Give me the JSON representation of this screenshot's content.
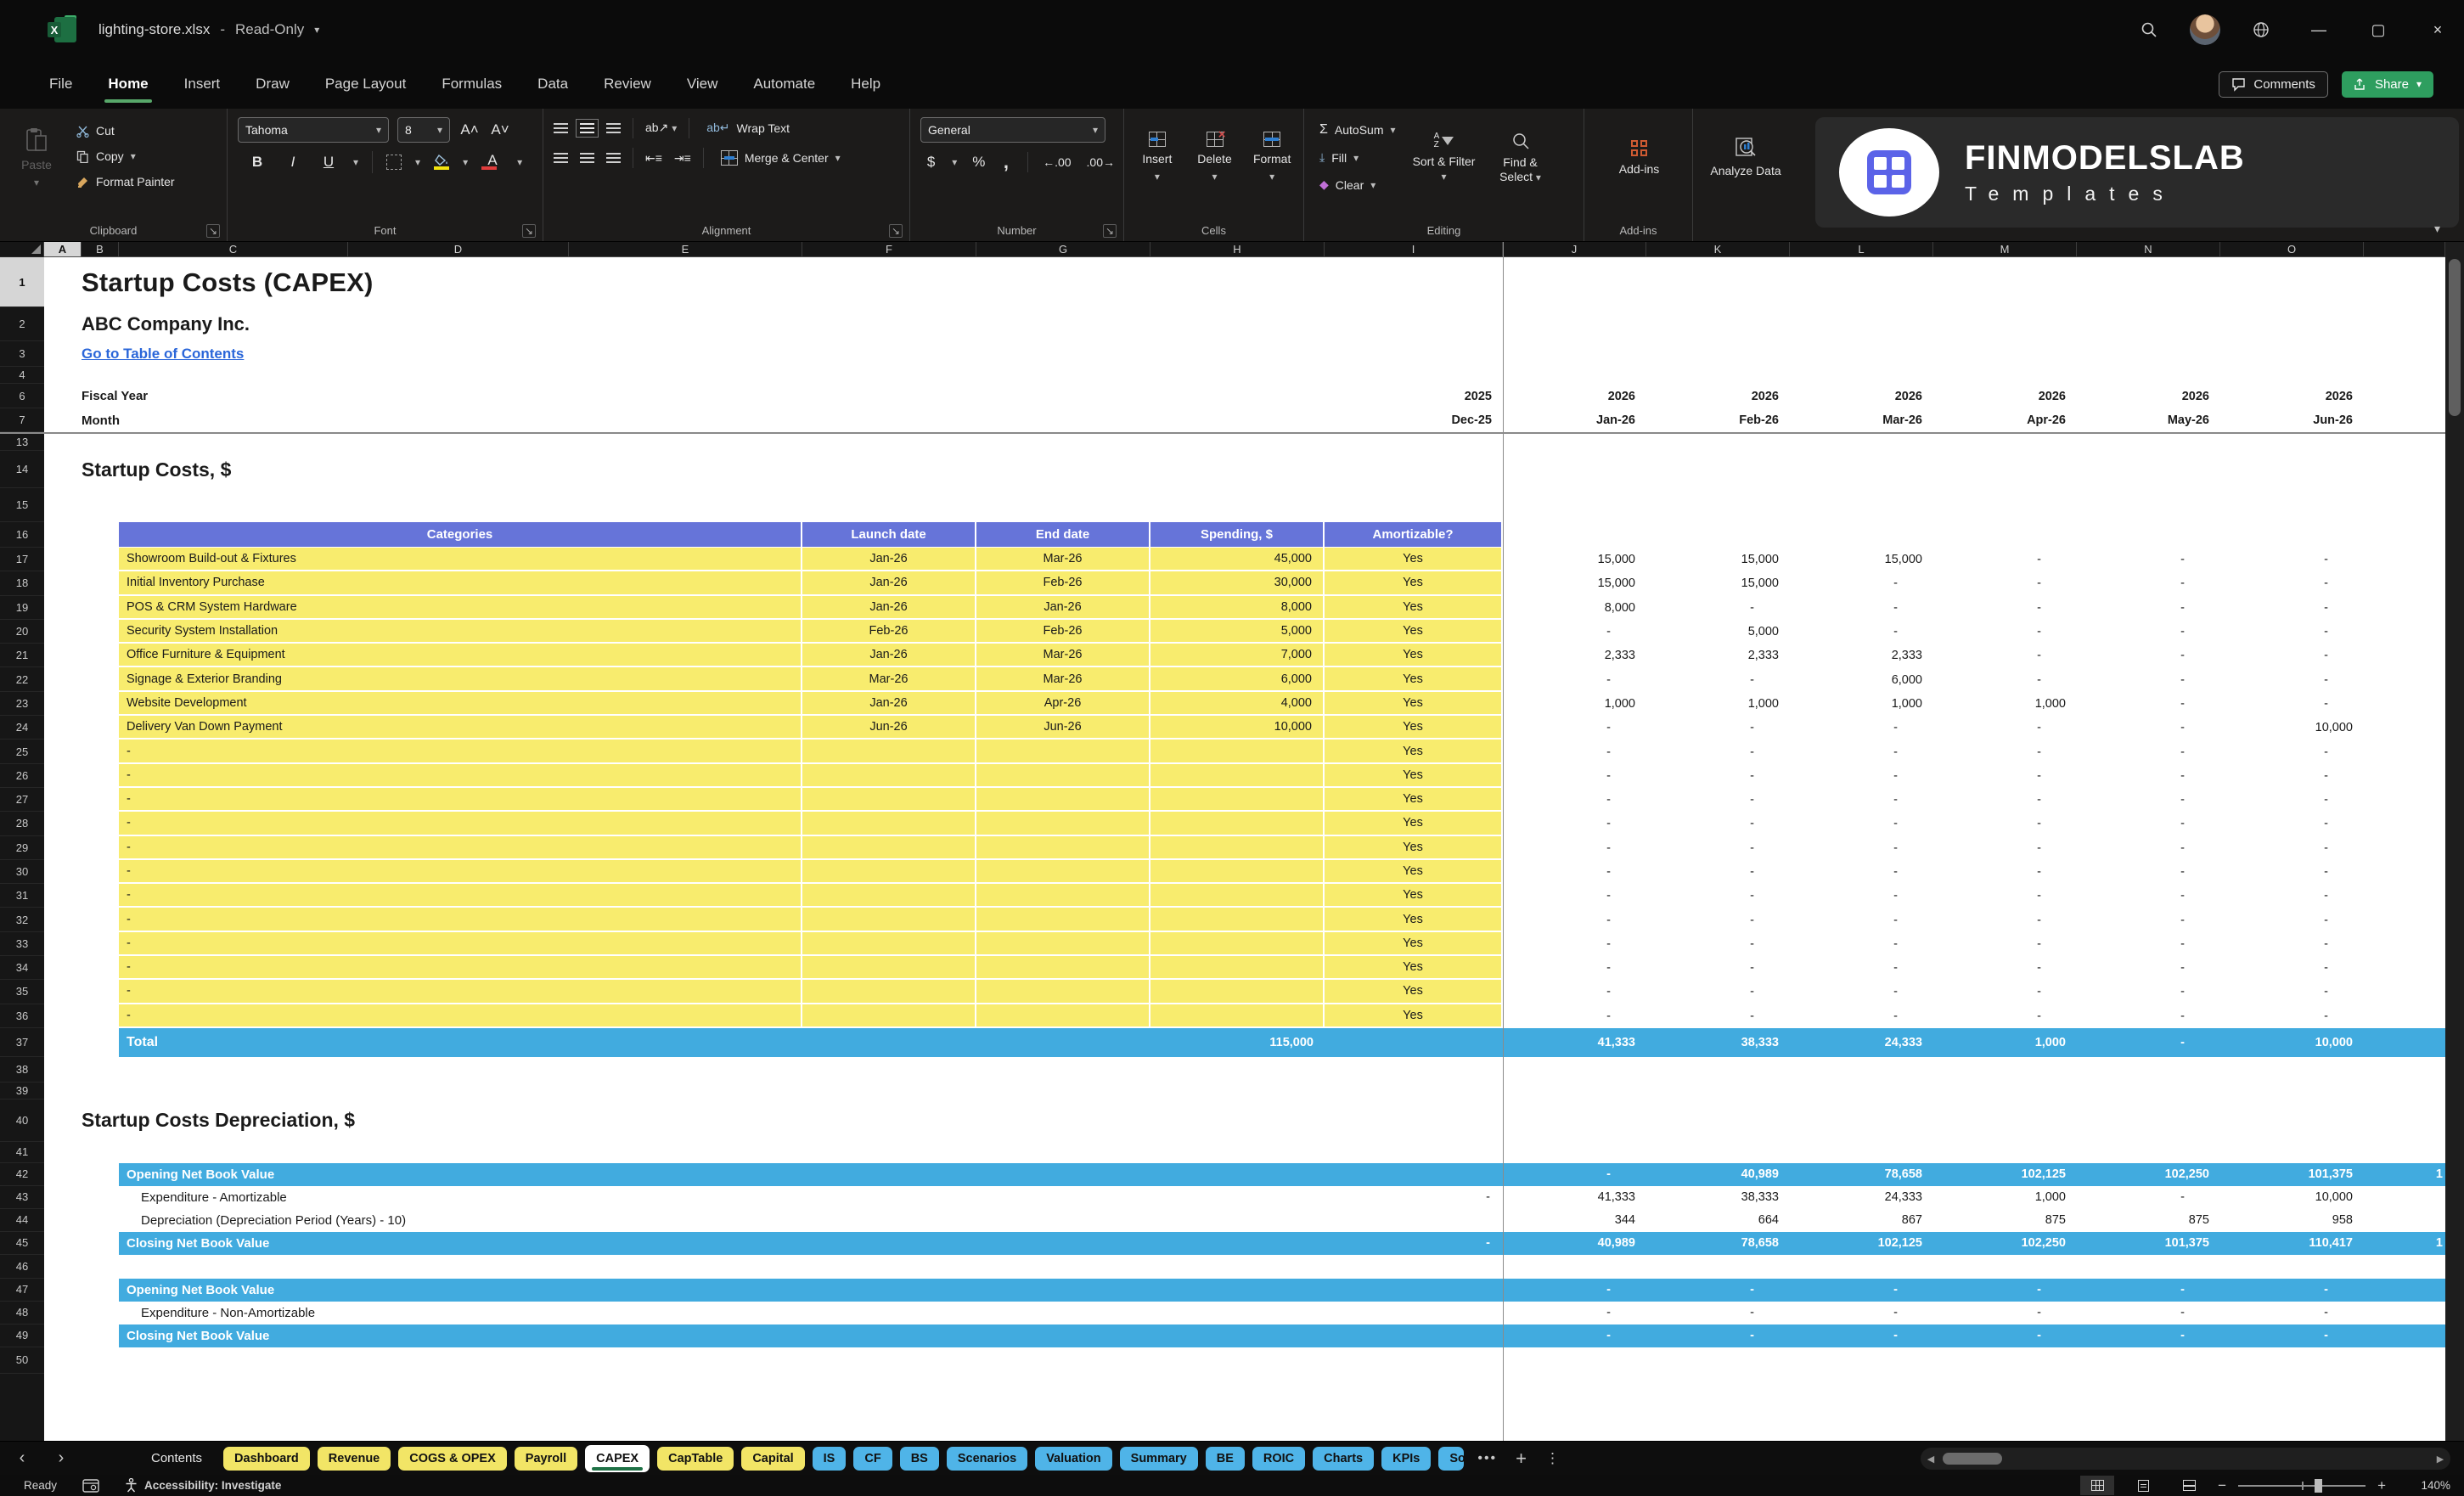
{
  "window": {
    "file_name": "lighting-store.xlsx",
    "separator": "-",
    "mode": "Read-Only"
  },
  "menu": {
    "items": [
      "File",
      "Home",
      "Insert",
      "Draw",
      "Page Layout",
      "Formulas",
      "Data",
      "Review",
      "View",
      "Automate",
      "Help"
    ],
    "active": "Home"
  },
  "top_actions": {
    "comments": "Comments",
    "share": "Share"
  },
  "ribbon": {
    "clipboard": {
      "label": "Clipboard",
      "paste": "Paste",
      "cut": "Cut",
      "copy": "Copy",
      "format_painter": "Format Painter"
    },
    "font": {
      "label": "Font",
      "font_name": "Tahoma",
      "font_size": "8",
      "bold": "B",
      "italic": "I",
      "underline": "U"
    },
    "alignment": {
      "label": "Alignment",
      "wrap_text": "Wrap Text",
      "merge_center": "Merge & Center"
    },
    "number": {
      "label": "Number",
      "format": "General",
      "currency": "$",
      "percent": "%",
      "comma": ",",
      "inc_dec": "←.00",
      "dec_dec": ".00→"
    },
    "cells": {
      "label": "Cells",
      "insert": "Insert",
      "delete": "Delete",
      "format": "Format"
    },
    "editing": {
      "label": "Editing",
      "autosum": "AutoSum",
      "fill": "Fill",
      "clear": "Clear",
      "sort_filter": "Sort & Filter",
      "find_select": "Find & Select"
    },
    "addins": {
      "label": "Add-ins",
      "addins": "Add-ins",
      "analyze": "Analyze Data"
    }
  },
  "brand": {
    "name": "FINMODELSLAB",
    "sub": "Templates"
  },
  "sheet": {
    "columns": [
      "A",
      "B",
      "C",
      "D",
      "E",
      "F",
      "G",
      "H",
      "I",
      "J",
      "K",
      "L",
      "M",
      "N",
      "O"
    ],
    "row_numbers": [
      "1",
      "2",
      "3",
      "4",
      "6",
      "7",
      "13",
      "14",
      "15",
      "16",
      "17",
      "18",
      "19",
      "20",
      "21",
      "22",
      "23",
      "24",
      "25",
      "26",
      "27",
      "28",
      "29",
      "30",
      "31",
      "32",
      "33",
      "34",
      "35",
      "36",
      "37",
      "38",
      "39",
      "40",
      "41",
      "42",
      "43",
      "44",
      "45",
      "46",
      "47",
      "48",
      "49",
      "50"
    ],
    "title": "Startup Costs (CAPEX)",
    "company": "ABC Company Inc.",
    "link": "Go to Table of Contents",
    "fiscal_year_label": "Fiscal Year",
    "month_label": "Month",
    "fiscal_years": [
      "2025",
      "2026",
      "2026",
      "2026",
      "2026",
      "2026",
      "2026"
    ],
    "months": [
      "Dec-25",
      "Jan-26",
      "Feb-26",
      "Mar-26",
      "Apr-26",
      "May-26",
      "Jun-26"
    ],
    "section1": "Startup Costs, $",
    "table_headers": [
      "Categories",
      "Launch date",
      "End date",
      "Spending, $",
      "Amortizable?"
    ],
    "rows": [
      {
        "category": "Showroom Build-out & Fixtures",
        "launch": "Jan-26",
        "end": "Mar-26",
        "spending": "45,000",
        "amortizable": "Yes",
        "monthly": [
          "15,000",
          "15,000",
          "15,000",
          "-",
          "-",
          "-"
        ]
      },
      {
        "category": "Initial Inventory Purchase",
        "launch": "Jan-26",
        "end": "Feb-26",
        "spending": "30,000",
        "amortizable": "Yes",
        "monthly": [
          "15,000",
          "15,000",
          "-",
          "-",
          "-",
          "-"
        ]
      },
      {
        "category": "POS & CRM System Hardware",
        "launch": "Jan-26",
        "end": "Jan-26",
        "spending": "8,000",
        "amortizable": "Yes",
        "monthly": [
          "8,000",
          "-",
          "-",
          "-",
          "-",
          "-"
        ]
      },
      {
        "category": "Security System Installation",
        "launch": "Feb-26",
        "end": "Feb-26",
        "spending": "5,000",
        "amortizable": "Yes",
        "monthly": [
          "-",
          "5,000",
          "-",
          "-",
          "-",
          "-"
        ]
      },
      {
        "category": "Office Furniture & Equipment",
        "launch": "Jan-26",
        "end": "Mar-26",
        "spending": "7,000",
        "amortizable": "Yes",
        "monthly": [
          "2,333",
          "2,333",
          "2,333",
          "-",
          "-",
          "-"
        ]
      },
      {
        "category": "Signage & Exterior Branding",
        "launch": "Mar-26",
        "end": "Mar-26",
        "spending": "6,000",
        "amortizable": "Yes",
        "monthly": [
          "-",
          "-",
          "6,000",
          "-",
          "-",
          "-"
        ]
      },
      {
        "category": "Website Development",
        "launch": "Jan-26",
        "end": "Apr-26",
        "spending": "4,000",
        "amortizable": "Yes",
        "monthly": [
          "1,000",
          "1,000",
          "1,000",
          "1,000",
          "-",
          "-"
        ]
      },
      {
        "category": "Delivery Van Down Payment",
        "launch": "Jun-26",
        "end": "Jun-26",
        "spending": "10,000",
        "amortizable": "Yes",
        "monthly": [
          "-",
          "-",
          "-",
          "-",
          "-",
          "10,000"
        ]
      },
      {
        "category": "-",
        "launch": "",
        "end": "",
        "spending": "",
        "amortizable": "Yes",
        "monthly": [
          "-",
          "-",
          "-",
          "-",
          "-",
          "-"
        ]
      },
      {
        "category": "-",
        "launch": "",
        "end": "",
        "spending": "",
        "amortizable": "Yes",
        "monthly": [
          "-",
          "-",
          "-",
          "-",
          "-",
          "-"
        ]
      },
      {
        "category": "-",
        "launch": "",
        "end": "",
        "spending": "",
        "amortizable": "Yes",
        "monthly": [
          "-",
          "-",
          "-",
          "-",
          "-",
          "-"
        ]
      },
      {
        "category": "-",
        "launch": "",
        "end": "",
        "spending": "",
        "amortizable": "Yes",
        "monthly": [
          "-",
          "-",
          "-",
          "-",
          "-",
          "-"
        ]
      },
      {
        "category": "-",
        "launch": "",
        "end": "",
        "spending": "",
        "amortizable": "Yes",
        "monthly": [
          "-",
          "-",
          "-",
          "-",
          "-",
          "-"
        ]
      },
      {
        "category": "-",
        "launch": "",
        "end": "",
        "spending": "",
        "amortizable": "Yes",
        "monthly": [
          "-",
          "-",
          "-",
          "-",
          "-",
          "-"
        ]
      },
      {
        "category": "-",
        "launch": "",
        "end": "",
        "spending": "",
        "amortizable": "Yes",
        "monthly": [
          "-",
          "-",
          "-",
          "-",
          "-",
          "-"
        ]
      },
      {
        "category": "-",
        "launch": "",
        "end": "",
        "spending": "",
        "amortizable": "Yes",
        "monthly": [
          "-",
          "-",
          "-",
          "-",
          "-",
          "-"
        ]
      },
      {
        "category": "-",
        "launch": "",
        "end": "",
        "spending": "",
        "amortizable": "Yes",
        "monthly": [
          "-",
          "-",
          "-",
          "-",
          "-",
          "-"
        ]
      },
      {
        "category": "-",
        "launch": "",
        "end": "",
        "spending": "",
        "amortizable": "Yes",
        "monthly": [
          "-",
          "-",
          "-",
          "-",
          "-",
          "-"
        ]
      },
      {
        "category": "-",
        "launch": "",
        "end": "",
        "spending": "",
        "amortizable": "Yes",
        "monthly": [
          "-",
          "-",
          "-",
          "-",
          "-",
          "-"
        ]
      },
      {
        "category": "-",
        "launch": "",
        "end": "",
        "spending": "",
        "amortizable": "Yes",
        "monthly": [
          "-",
          "-",
          "-",
          "-",
          "-",
          "-"
        ]
      }
    ],
    "total": {
      "label": "Total",
      "spending": "115,000",
      "monthly": [
        "41,333",
        "38,333",
        "24,333",
        "1,000",
        "-",
        "10,000"
      ]
    },
    "section2": "Startup Costs Depreciation, $",
    "dep1": {
      "opening": {
        "label": "Opening Net Book Value",
        "dec": "",
        "monthly": [
          "-",
          "40,989",
          "78,658",
          "102,125",
          "102,250",
          "101,375"
        ],
        "overflow": "1"
      },
      "expenditure": {
        "label": "Expenditure - Amortizable",
        "dec": "-",
        "monthly": [
          "41,333",
          "38,333",
          "24,333",
          "1,000",
          "-",
          "10,000"
        ]
      },
      "depreciation": {
        "label": "Depreciation (Depreciation Period (Years) - 10)",
        "dec": "",
        "monthly": [
          "344",
          "664",
          "867",
          "875",
          "875",
          "958"
        ]
      },
      "closing": {
        "label": "Closing Net Book Value",
        "dec": "-",
        "monthly": [
          "40,989",
          "78,658",
          "102,125",
          "102,250",
          "101,375",
          "110,417"
        ],
        "overflow": "1"
      }
    },
    "dep2": {
      "opening": {
        "label": "Opening Net Book Value",
        "monthly": [
          "-",
          "-",
          "-",
          "-",
          "-",
          "-"
        ]
      },
      "expenditure": {
        "label": "Expenditure - Non-Amortizable",
        "monthly": [
          "-",
          "-",
          "-",
          "-",
          "-",
          "-"
        ]
      },
      "closing": {
        "label": "Closing Net Book Value",
        "monthly": [
          "-",
          "-",
          "-",
          "-",
          "-",
          "-"
        ]
      }
    }
  },
  "tabs": {
    "items": [
      {
        "label": "Contents",
        "color": "plain"
      },
      {
        "label": "Dashboard",
        "color": "yellow"
      },
      {
        "label": "Revenue",
        "color": "yellow"
      },
      {
        "label": "COGS & OPEX",
        "color": "yellow"
      },
      {
        "label": "Payroll",
        "color": "yellow"
      },
      {
        "label": "CAPEX",
        "color": "active"
      },
      {
        "label": "CapTable",
        "color": "yellow"
      },
      {
        "label": "Capital",
        "color": "yellow"
      },
      {
        "label": "IS",
        "color": "blue"
      },
      {
        "label": "CF",
        "color": "blue"
      },
      {
        "label": "BS",
        "color": "blue"
      },
      {
        "label": "Scenarios",
        "color": "blue"
      },
      {
        "label": "Valuation",
        "color": "blue"
      },
      {
        "label": "Summary",
        "color": "blue"
      },
      {
        "label": "BE",
        "color": "blue"
      },
      {
        "label": "ROIC",
        "color": "blue"
      },
      {
        "label": "Charts",
        "color": "blue"
      },
      {
        "label": "KPIs",
        "color": "blue"
      },
      {
        "label": "So",
        "color": "blue",
        "truncated": true
      }
    ]
  },
  "status": {
    "ready": "Ready",
    "accessibility": "Accessibility: Investigate",
    "zoom": "140%"
  },
  "colors": {
    "header_blue": "#6674d9",
    "row_yellow": "#f8ec6e",
    "band_blue": "#41abdf",
    "tab_yellow": "#f2e566",
    "tab_blue": "#4fb4e8",
    "active_green": "#1e7145",
    "share_green": "#2e9e5f",
    "link_blue": "#2a66d9",
    "green_underline": "#58a86a"
  }
}
